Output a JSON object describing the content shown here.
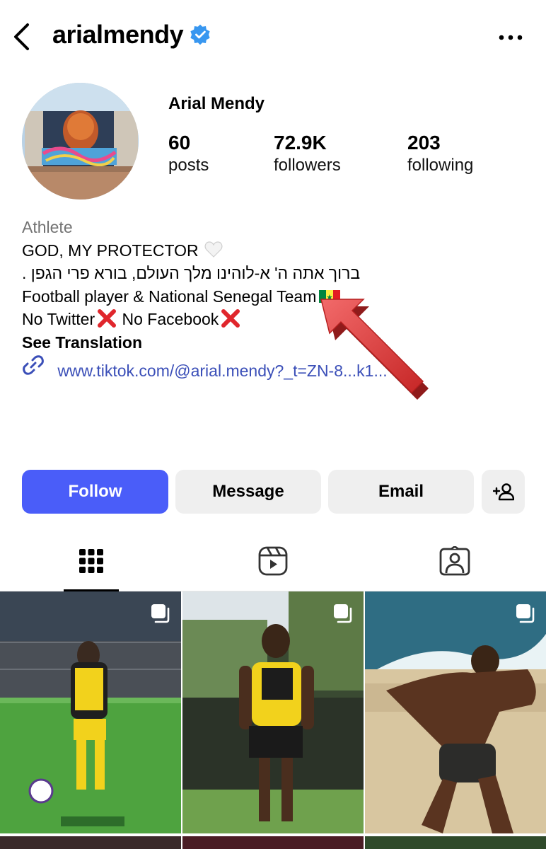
{
  "header": {
    "username": "arialmendy",
    "verified": true,
    "back_icon": "chevron-left-icon",
    "more_icon": "more-horizontal-icon"
  },
  "profile": {
    "display_name": "Arial Mendy",
    "stats": [
      {
        "value": "60",
        "label": "posts"
      },
      {
        "value": "72.9K",
        "label": "followers"
      },
      {
        "value": "203",
        "label": "following"
      }
    ]
  },
  "bio": {
    "category": "Athlete",
    "line1": "GOD, MY PROTECTOR",
    "line2": "ברוך אתה ה' א-לוהינו מלך העולם, בורא פרי הגפן .",
    "line3": "Football player & National Senegal Team",
    "line4a": "No Twitter",
    "line4b": " No Facebook",
    "see_translation": "See Translation",
    "link": "www.tiktok.com/@arial.mendy?_t=ZN-8...k1..."
  },
  "actions": {
    "follow": "Follow",
    "message": "Message",
    "email": "Email",
    "suggest_icon": "add-person-icon"
  },
  "tabs": [
    {
      "name": "posts-grid",
      "icon": "grid-icon",
      "active": true
    },
    {
      "name": "reels",
      "icon": "reels-icon",
      "active": false
    },
    {
      "name": "tagged",
      "icon": "tagged-person-icon",
      "active": false
    }
  ],
  "colors": {
    "follow_bg": "#4a5df9",
    "secondary_btn_bg": "#efefef",
    "link": "#3b4fb8",
    "verified": "#3897f0",
    "category": "#737373",
    "annotation_arrow": "#e33b3b"
  }
}
